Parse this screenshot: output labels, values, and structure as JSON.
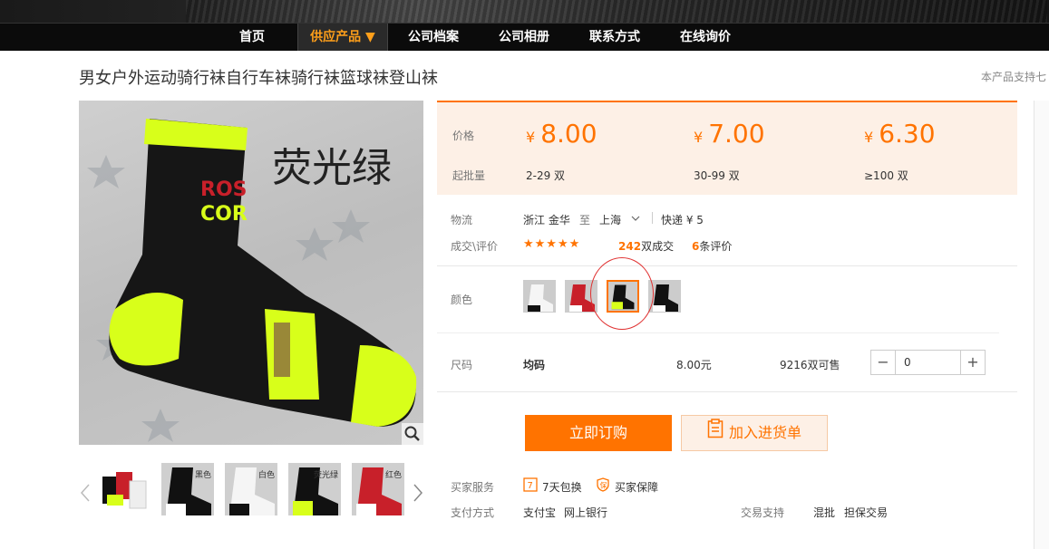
{
  "nav": {
    "items": [
      "首页",
      "供应产品 ▼",
      "公司档案",
      "公司相册",
      "联系方式",
      "在线询价"
    ]
  },
  "product": {
    "title": "男女户外运动骑行袜自行车袜骑行袜篮球袜登山袜",
    "support_text": "本产品支持七",
    "image_caption": "荧光绿",
    "thumb_labels": [
      "",
      "黑色",
      "白色",
      "荧光绿",
      "红色"
    ]
  },
  "pricing": {
    "price_label": "价格",
    "batch_label": "起批量",
    "yen": "¥",
    "tiers": [
      {
        "price": "8.00",
        "range": "2-29 双"
      },
      {
        "price": "7.00",
        "range": "30-99 双"
      },
      {
        "price": "6.30",
        "range": "≥100 双"
      }
    ]
  },
  "logistics": {
    "label": "物流",
    "from": "浙江 金华",
    "to_word": "至",
    "dest": "上海",
    "express": "快递 ¥ 5"
  },
  "deals": {
    "label": "成交\\评价",
    "stars": "★★★★★",
    "sold_count": "242",
    "sold_suffix": "双成交",
    "review_count": "6",
    "review_suffix": "条评价"
  },
  "color": {
    "label": "颜色",
    "selected_index": 2
  },
  "size": {
    "label": "尺码",
    "value": "均码",
    "unit_price": "8.00元",
    "stock": "9216双可售",
    "quantity": "0",
    "minus": "−",
    "plus": "+"
  },
  "actions": {
    "buy": "立即订购",
    "cart": "加入进货单"
  },
  "services": {
    "buyer_label": "买家服务",
    "items": [
      "7天包换",
      "买家保障"
    ],
    "pay_label": "支付方式",
    "pay_items": [
      "支付宝",
      "网上银行"
    ],
    "trade_label": "交易支持",
    "trade_items": [
      "混批",
      "担保交易"
    ]
  },
  "colors": {
    "accent": "#ff7300",
    "price_bg": "#fdf0e6",
    "nav_bg": "#0b0b0b",
    "nav_active_text": "#ff9f1a",
    "annotation_circle": "#e03030"
  }
}
